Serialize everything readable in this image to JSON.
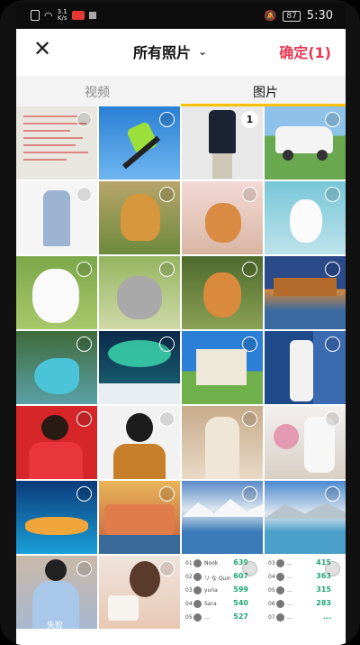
{
  "status_bar": {
    "net_speed_value": "3.1",
    "net_speed_unit": "K/s",
    "battery": "87",
    "time": "5:30"
  },
  "header": {
    "album_title": "所有照片",
    "confirm_label": "确定(1)"
  },
  "tabs": [
    {
      "label": "视频",
      "active": false
    },
    {
      "label": "图片",
      "active": true
    }
  ],
  "grid": {
    "selected_badge": "1",
    "ranking_cards": [
      {
        "rows": [
          {
            "rank": "01",
            "name": "Nook",
            "score": "639"
          },
          {
            "rank": "02",
            "name": "リ な Quinn",
            "score": "607"
          },
          {
            "rank": "03",
            "name": "yuna",
            "score": "599"
          },
          {
            "rank": "04",
            "name": "Sara",
            "score": "540"
          },
          {
            "rank": "05",
            "name": "...",
            "score": "527"
          }
        ]
      },
      {
        "rows": [
          {
            "rank": "03",
            "name": "...",
            "score": "415"
          },
          {
            "rank": "04",
            "name": "...",
            "score": "363"
          },
          {
            "rank": "05",
            "name": "...",
            "score": "315"
          },
          {
            "rank": "06",
            "name": "...",
            "score": "283"
          },
          {
            "rank": "07",
            "name": "...",
            "score": "..."
          }
        ]
      }
    ],
    "caption_bottom_left": "失败"
  },
  "colors": {
    "accent_red": "#e53953",
    "tab_indicator": "#ffc107",
    "score_green": "#1ea672"
  }
}
